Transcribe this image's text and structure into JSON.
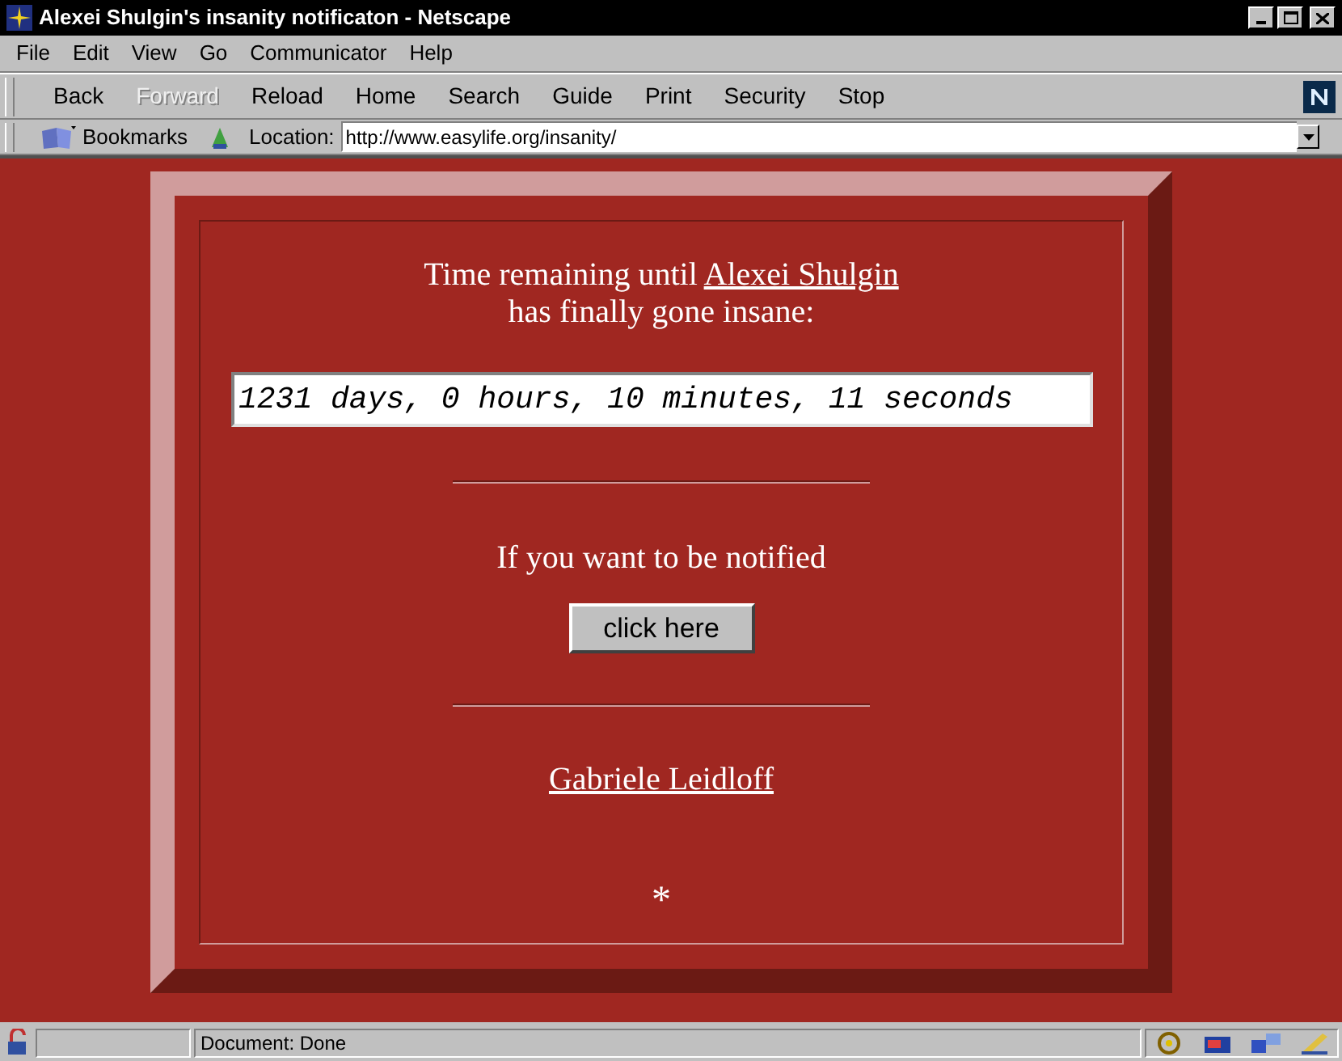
{
  "window": {
    "title": "Alexei Shulgin's insanity notificaton - Netscape"
  },
  "menu": [
    "File",
    "Edit",
    "View",
    "Go",
    "Communicator",
    "Help"
  ],
  "toolbar": [
    {
      "label": "Back",
      "disabled": false
    },
    {
      "label": "Forward",
      "disabled": true
    },
    {
      "label": "Reload",
      "disabled": false
    },
    {
      "label": "Home",
      "disabled": false
    },
    {
      "label": "Search",
      "disabled": false
    },
    {
      "label": "Guide",
      "disabled": false
    },
    {
      "label": "Print",
      "disabled": false
    },
    {
      "label": "Security",
      "disabled": false
    },
    {
      "label": "Stop",
      "disabled": false
    }
  ],
  "location_bar": {
    "bookmarks": "Bookmarks",
    "label": "Location:",
    "url": "http://www.easylife.org/insanity/"
  },
  "page": {
    "heading_before": "Time remaining until ",
    "heading_link": "Alexei Shulgin",
    "heading_after": "has finally gone insane:",
    "countdown": "1231 days, 0 hours, 10 minutes, 11 seconds",
    "notify_text": "If you want to be notified",
    "button": "click here",
    "author_link": "Gabriele Leidloff",
    "footer_mark": "*"
  },
  "status_bar": {
    "text": "Document: Done"
  }
}
